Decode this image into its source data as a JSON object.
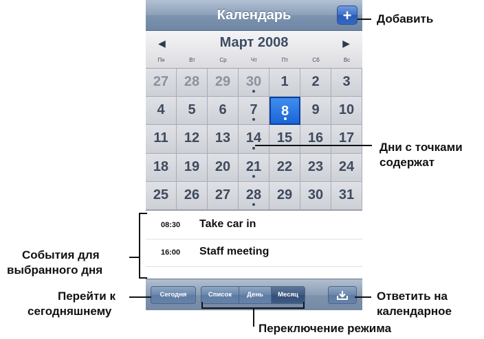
{
  "title": "Календарь",
  "add_glyph": "+",
  "month": "Март 2008",
  "prev_glyph": "◀",
  "next_glyph": "▶",
  "weekdays": [
    "Пн",
    "Вт",
    "Ср",
    "Чт",
    "Пт",
    "Сб",
    "Вс"
  ],
  "days": [
    {
      "n": "27",
      "other": true,
      "dot": false
    },
    {
      "n": "28",
      "other": true,
      "dot": false
    },
    {
      "n": "29",
      "other": true,
      "dot": false
    },
    {
      "n": "30",
      "other": true,
      "dot": true
    },
    {
      "n": "1",
      "other": false,
      "dot": false
    },
    {
      "n": "2",
      "other": false,
      "dot": false
    },
    {
      "n": "3",
      "other": false,
      "dot": false
    },
    {
      "n": "4",
      "other": false,
      "dot": false
    },
    {
      "n": "5",
      "other": false,
      "dot": false
    },
    {
      "n": "6",
      "other": false,
      "dot": false
    },
    {
      "n": "7",
      "other": false,
      "dot": true
    },
    {
      "n": "8",
      "other": false,
      "dot": true,
      "selected": true
    },
    {
      "n": "9",
      "other": false,
      "dot": false
    },
    {
      "n": "10",
      "other": false,
      "dot": false
    },
    {
      "n": "11",
      "other": false,
      "dot": false
    },
    {
      "n": "12",
      "other": false,
      "dot": false
    },
    {
      "n": "13",
      "other": false,
      "dot": false
    },
    {
      "n": "14",
      "other": false,
      "dot": true
    },
    {
      "n": "15",
      "other": false,
      "dot": false
    },
    {
      "n": "16",
      "other": false,
      "dot": false
    },
    {
      "n": "17",
      "other": false,
      "dot": false
    },
    {
      "n": "18",
      "other": false,
      "dot": false
    },
    {
      "n": "19",
      "other": false,
      "dot": false
    },
    {
      "n": "20",
      "other": false,
      "dot": false
    },
    {
      "n": "21",
      "other": false,
      "dot": true
    },
    {
      "n": "22",
      "other": false,
      "dot": false
    },
    {
      "n": "23",
      "other": false,
      "dot": false
    },
    {
      "n": "24",
      "other": false,
      "dot": false
    },
    {
      "n": "25",
      "other": false,
      "dot": false
    },
    {
      "n": "26",
      "other": false,
      "dot": false
    },
    {
      "n": "27",
      "other": false,
      "dot": false
    },
    {
      "n": "28",
      "other": false,
      "dot": true
    },
    {
      "n": "29",
      "other": false,
      "dot": false
    },
    {
      "n": "30",
      "other": false,
      "dot": false
    },
    {
      "n": "31",
      "other": false,
      "dot": false
    }
  ],
  "events": [
    {
      "time": "08:30",
      "title": "Take car in"
    },
    {
      "time": "16:00",
      "title": "Staff meeting"
    }
  ],
  "toolbar": {
    "today": "Сегодня",
    "modes": [
      "Список",
      "День",
      "Месяц"
    ],
    "active_mode": "Месяц",
    "inbox_icon": "download-tray-icon"
  },
  "callouts": {
    "add": "Добавить",
    "dots_1": "Дни с точками",
    "dots_2": "содержат",
    "events_1": "События для",
    "events_2": "выбранного дня",
    "today_1": "Перейти к",
    "today_2": "сегодняшнему",
    "reply_1": "Ответить на",
    "reply_2": "календарное",
    "mode": "Переключение режима"
  },
  "colors": {
    "accent": "#1c64d8",
    "titlebar": "#7d93ae",
    "grid_bg": "#cdd0d6"
  }
}
